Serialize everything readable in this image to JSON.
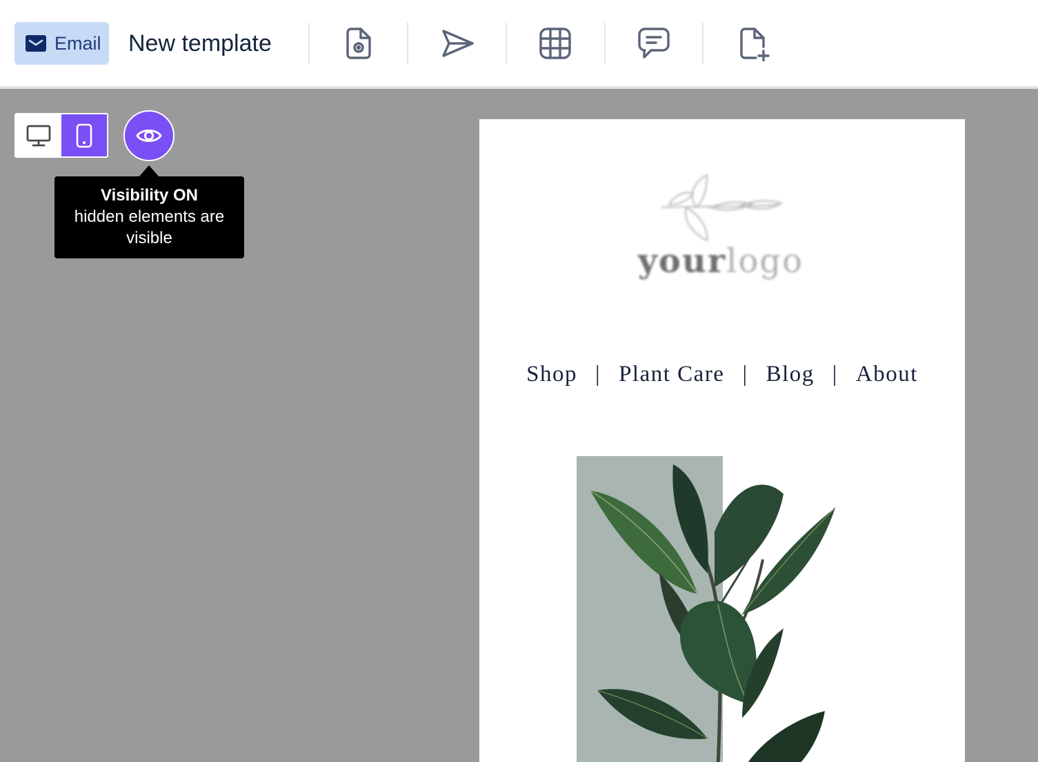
{
  "toolbar": {
    "channel_label": "Email",
    "template_name": "New template",
    "actions": [
      {
        "name": "preview-file-icon"
      },
      {
        "name": "send-icon"
      },
      {
        "name": "grid-icon"
      },
      {
        "name": "comment-icon"
      },
      {
        "name": "new-file-icon"
      }
    ]
  },
  "canvas": {
    "device_modes": [
      "desktop",
      "mobile"
    ],
    "active_device": "mobile",
    "accent_color": "#7a4ff5",
    "tooltip": {
      "title": "Visibility ON",
      "body": "hidden elements are visible"
    }
  },
  "email": {
    "logo": {
      "part1": "your",
      "part2": "logo"
    },
    "nav": {
      "items": [
        "Shop",
        "Plant Care",
        "Blog",
        "About"
      ],
      "separator": "|"
    }
  }
}
